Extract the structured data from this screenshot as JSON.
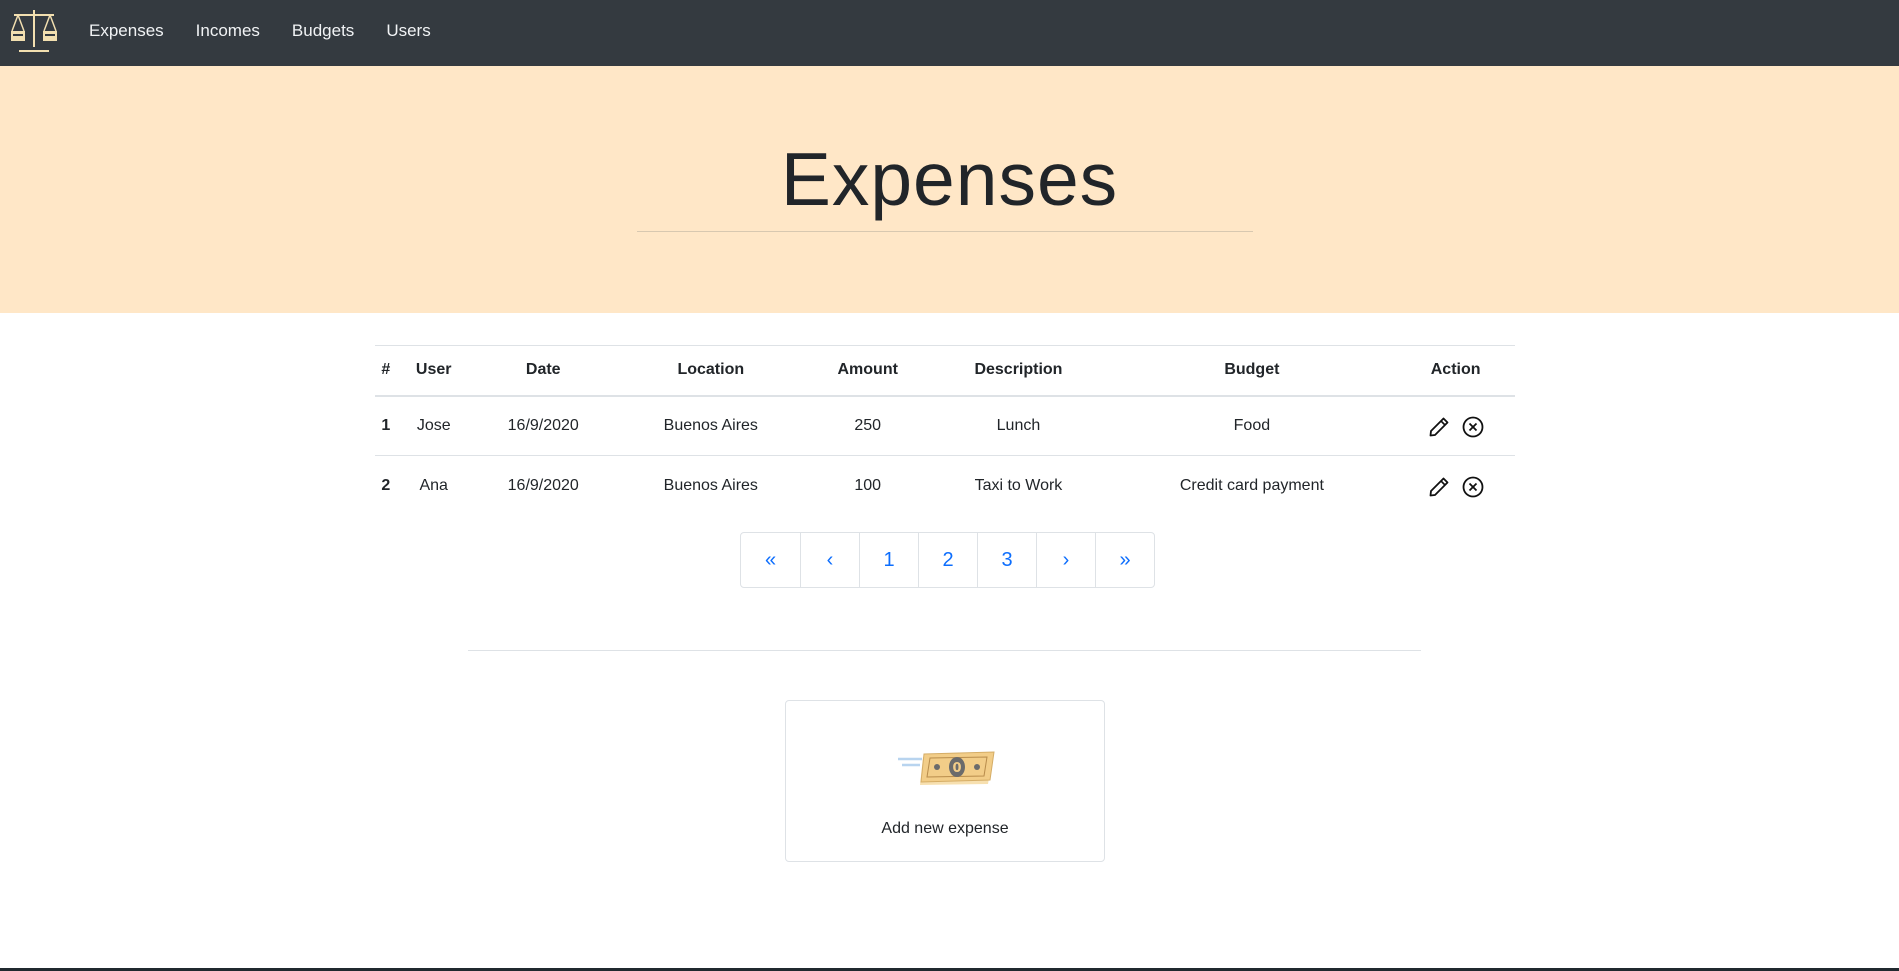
{
  "nav": {
    "links": [
      {
        "label": "Expenses"
      },
      {
        "label": "Incomes"
      },
      {
        "label": "Budgets"
      },
      {
        "label": "Users"
      }
    ]
  },
  "hero": {
    "title": "Expenses"
  },
  "table": {
    "headers": [
      "#",
      "User",
      "Date",
      "Location",
      "Amount",
      "Description",
      "Budget",
      "Action"
    ],
    "rows": [
      {
        "num": "1",
        "user": "Jose",
        "date": "16/9/2020",
        "location": "Buenos Aires",
        "amount": "250",
        "description": "Lunch",
        "budget": "Food"
      },
      {
        "num": "2",
        "user": "Ana",
        "date": "16/9/2020",
        "location": "Buenos Aires",
        "amount": "100",
        "description": "Taxi to Work",
        "budget": "Credit card payment"
      }
    ]
  },
  "pagination": {
    "items": [
      "«",
      "‹",
      "1",
      "2",
      "3",
      "›",
      "»"
    ]
  },
  "add_card": {
    "label": "Add new expense"
  },
  "colors": {
    "navbar": "#343a40",
    "hero": "#ffe7c7",
    "link": "#0d6efd"
  },
  "icons": {
    "logo": "balance-scale-icon",
    "edit": "pencil-icon",
    "delete": "circle-x-icon",
    "add": "money-bill-icon"
  }
}
